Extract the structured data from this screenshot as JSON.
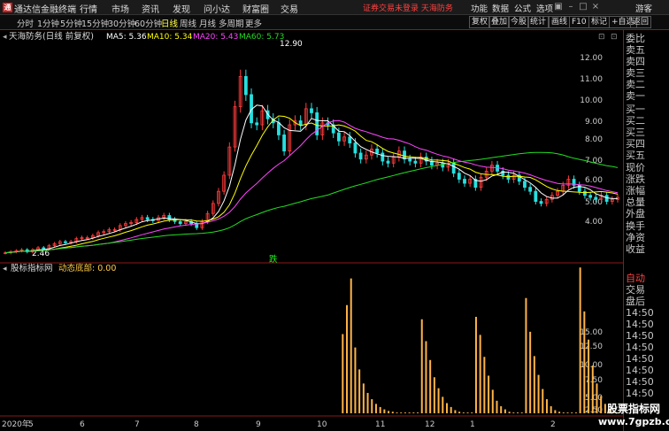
{
  "titlebar": {
    "app_title": "通达信金融终端",
    "logo": "通",
    "menu": [
      "行情",
      "市场",
      "资讯",
      "发现",
      "问小达",
      "财富圈",
      "交易"
    ],
    "alert": "证券交易未登录  天海防务",
    "right_menu": [
      "功能",
      "数据",
      "公式",
      "选项"
    ],
    "guest": "游客"
  },
  "toolbar": {
    "periods": [
      "分时",
      "1分钟",
      "5分钟",
      "15分钟",
      "30分钟",
      "60分钟",
      "日线",
      "周线",
      "月线",
      "多周期",
      "更多"
    ],
    "active_period": "日线",
    "buttons": [
      "复权",
      "叠加",
      "今股",
      "统计",
      "画线",
      "F10",
      "标记",
      "+自选",
      "返回"
    ]
  },
  "main_panel": {
    "stock": "天海防务(日线 前复权)",
    "ma5": "MA5: 5.36",
    "ma10": "MA10: 5.34",
    "ma20": "MA20: 5.43",
    "ma60": "MA60: 5.73",
    "high_label": "12.90",
    "low_label": "2.46",
    "marker": "跌",
    "y_labels": [
      "12.00",
      "11.00",
      "10.00",
      "9.00",
      "8.00",
      "7.00",
      "6.00",
      "5.00",
      "4.00"
    ],
    "colors": {
      "ma5": "#ffffff",
      "ma10": "#ffff00",
      "ma20": "#ff44ff",
      "ma60": "#22dd22"
    }
  },
  "sub_panel": {
    "indicator": "股标指标网",
    "line": "动态底部: 0.00",
    "y_labels": [
      "15.00",
      "12.50",
      "10.00",
      "7.50",
      "5.00",
      "2.50"
    ]
  },
  "x_axis": {
    "year": "2020年",
    "months": [
      "5",
      "6",
      "7",
      "8",
      "9",
      "10",
      "11",
      "12",
      "1",
      "2"
    ]
  },
  "side_panel": {
    "labels": [
      "委比",
      "卖五",
      "卖四",
      "卖三",
      "卖二",
      "卖一",
      "买一",
      "买二",
      "买三",
      "买四",
      "买五",
      "现价",
      "涨跌",
      "涨幅",
      "总量",
      "外盘",
      "换手",
      "净资",
      "收益",
      "自动",
      "交易",
      "盘后",
      "14:50",
      "14:50",
      "14:50",
      "14:50",
      "14:50",
      "14:50",
      "14:50",
      "14:50"
    ]
  },
  "watermark": {
    "line1": "股票指标网",
    "line2": "www.7gpzb.com"
  },
  "chart_data": {
    "type": "candlestick",
    "price_series": {
      "name": "天海防务",
      "y_range": [
        3.5,
        12.9
      ],
      "close": [
        2.55,
        2.6,
        2.65,
        2.7,
        2.6,
        2.7,
        2.8,
        2.75,
        2.9,
        3.0,
        3.1,
        3.05,
        3.1,
        3.25,
        3.3,
        3.3,
        3.4,
        3.55,
        3.6,
        3.7,
        3.7,
        3.9,
        4.0,
        4.05,
        4.2,
        4.3,
        4.2,
        4.15,
        4.3,
        4.4,
        4.2,
        4.1,
        4.0,
        4.1,
        4.0,
        3.8,
        4.1,
        4.5,
        5.0,
        5.6,
        6.4,
        7.8,
        9.8,
        11.3,
        10.4,
        9.0,
        8.9,
        9.6,
        9.2,
        9.0,
        8.4,
        7.6,
        8.9,
        9.1,
        8.9,
        9.7,
        9.5,
        8.4,
        9.0,
        8.9,
        8.5,
        8.1,
        8.3,
        8.0,
        7.5,
        7.2,
        7.4,
        7.7,
        7.5,
        7.1,
        7.0,
        7.3,
        7.6,
        7.2,
        7.1,
        7.0,
        7.3,
        7.1,
        6.9,
        7.0,
        6.8,
        7.0,
        6.5,
        6.2,
        6.0,
        6.2,
        5.8,
        6.3,
        6.6,
        6.9,
        6.6,
        6.4,
        6.2,
        6.4,
        6.1,
        5.8,
        5.6,
        5.1,
        5.0,
        5.2,
        5.4,
        5.6,
        5.9,
        6.2,
        5.9,
        5.6,
        5.4,
        5.3,
        5.2,
        5.4,
        5.1,
        5.2,
        5.3
      ]
    },
    "indicator_series": {
      "name": "动态底部",
      "y_range": [
        0,
        17.5
      ],
      "values": [
        0,
        0,
        0,
        0,
        0,
        0,
        0,
        0,
        0,
        0,
        0,
        0,
        0,
        0,
        0,
        0,
        0,
        0,
        0,
        0,
        0,
        0,
        0,
        0,
        0,
        0,
        0,
        0,
        0,
        0,
        0,
        0,
        0,
        0,
        0,
        0,
        0,
        0,
        0,
        0,
        0,
        0,
        0,
        0,
        0,
        0,
        0,
        0,
        0,
        0,
        0,
        0,
        0,
        0,
        0,
        0,
        0,
        0,
        0,
        0,
        0,
        0,
        0,
        0,
        0,
        0,
        0,
        0,
        0,
        0,
        0,
        0,
        0,
        0,
        0,
        0,
        0,
        0,
        0,
        0,
        0,
        10.1,
        13.8,
        17.2,
        8.4,
        5.6,
        3.8,
        2.6,
        1.8,
        1.2,
        0.8,
        0.5,
        0.3,
        0.2,
        0.1,
        0.1,
        0.1,
        0.1,
        0.1,
        0.1,
        12.0,
        9.2,
        6.8,
        4.6,
        3.2,
        2.1,
        1.3,
        0.8,
        0.4,
        0.2,
        0.1,
        0.1,
        0.1,
        12.3,
        10.0,
        7.2,
        4.8,
        3.0,
        1.6,
        0.9,
        0.5,
        0.2,
        0.1,
        0.1,
        0.1,
        14.7,
        10.4,
        7.3,
        4.9,
        3.1,
        1.8,
        0.9,
        0.4,
        0.2,
        0.1,
        0.1,
        0.1,
        0.1,
        18.6,
        13.0,
        9.4,
        6.1,
        3.8,
        2.2,
        1.2,
        0.5,
        0.2,
        0.1
      ]
    }
  }
}
